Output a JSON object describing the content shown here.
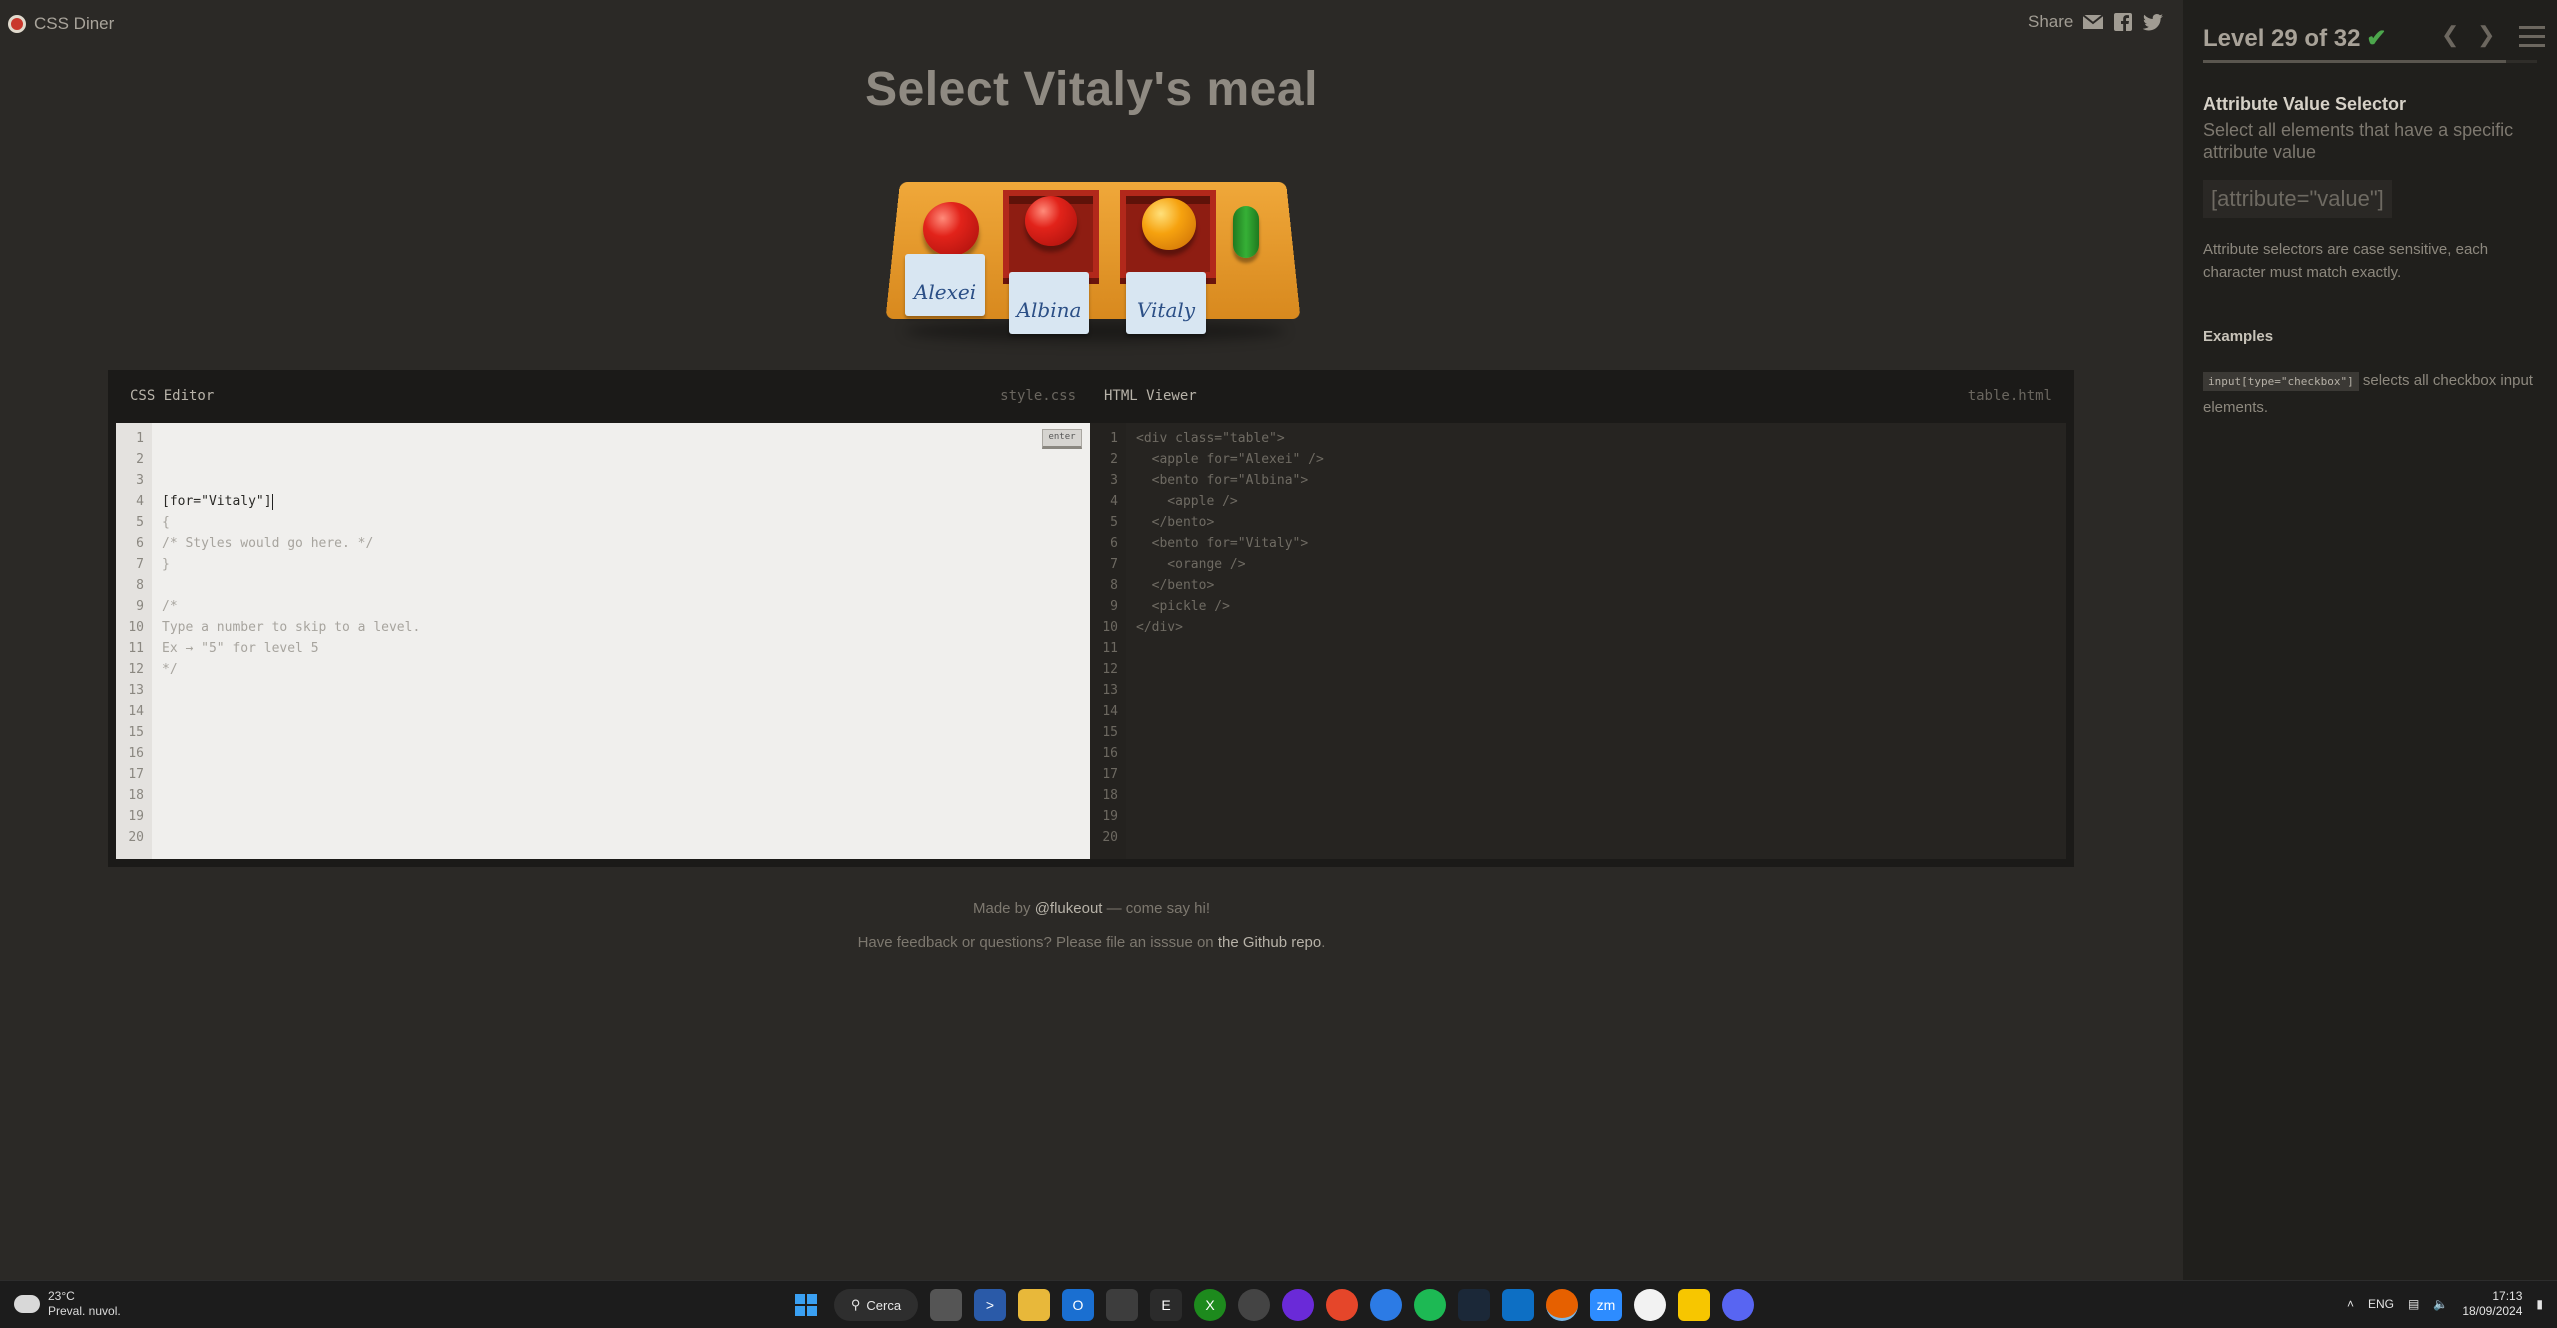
{
  "app": {
    "logo_text": "CSS Diner"
  },
  "share": {
    "label": "Share"
  },
  "title": "Select Vitaly's meal",
  "table": {
    "tags": [
      "Alexei",
      "Albina",
      "Vitaly"
    ]
  },
  "editor": {
    "css_title": "CSS Editor",
    "css_file": "style.css",
    "enter_label": "enter",
    "css_lines": [
      "[for=\"Vitaly\"]",
      "{",
      "/* Styles would go here. */",
      "}",
      "",
      "/*",
      "Type a number to skip to a level.",
      "Ex → \"5\" for level 5",
      "*/",
      "",
      "",
      "",
      "",
      "",
      "",
      "",
      "",
      "",
      "",
      ""
    ],
    "html_title": "HTML Viewer",
    "html_file": "table.html",
    "html_lines": [
      "<div class=\"table\">",
      "  <apple for=\"Alexei\" />",
      "  <bento for=\"Albina\">",
      "    <apple />",
      "  </bento>",
      "  <bento for=\"Vitaly\">",
      "    <orange />",
      "  </bento>",
      "  <pickle />",
      "</div>",
      "",
      "",
      "",
      "",
      "",
      "",
      "",
      "",
      "",
      ""
    ]
  },
  "footer": {
    "line1_pre": "Made by ",
    "line1_link": "@flukeout",
    "line1_post": " — come say hi!",
    "line2_pre": "Have feedback or questions? Please file an isssue on ",
    "line2_link": "the Github repo",
    "line2_post": "."
  },
  "sidebar": {
    "level_text": "Level 29 of 32",
    "check": "✔",
    "progress_fraction": 0.906,
    "selector_name": "Attribute Value Selector",
    "selector_title": "Select all elements that have a specific attribute value",
    "syntax": "[attribute=\"value\"]",
    "hint": "Attribute selectors are case sensitive, each character must match exactly.",
    "examples_title": "Examples",
    "example_code": "input[type=\"checkbox\"]",
    "example_text": " selects all checkbox input elements."
  },
  "taskbar": {
    "temp": "23°C",
    "weather": "Preval. nuvol.",
    "search": "Cerca",
    "lang": "ENG",
    "time": "17:13",
    "date": "18/09/2024"
  },
  "colors": {
    "background": "#2b2926",
    "sidebar": "#201f1c",
    "accent_check": "#4ca64c",
    "apple": "#e2231a",
    "orange": "#f6a20f",
    "pickle": "#36b036",
    "bento": "#8e1d12",
    "table": "#f0a83a"
  }
}
